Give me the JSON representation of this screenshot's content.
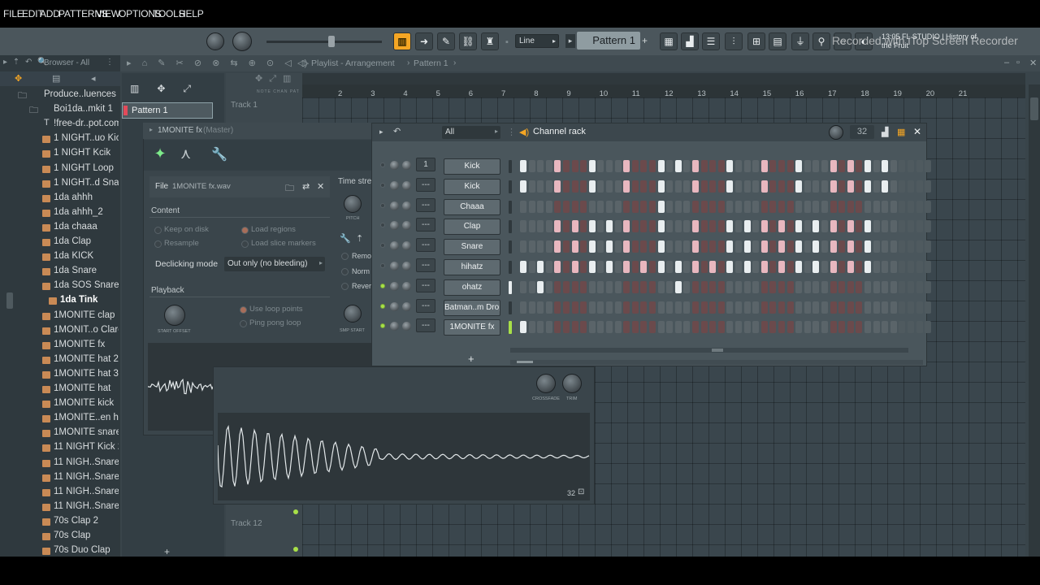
{
  "watermark": {
    "text": "Recorded with iTop Screen Recorder",
    "hint_line1": "13:05 FL STUDIO | History of",
    "hint_line2": "the Fruit"
  },
  "menu": [
    "FILE",
    "EDIT",
    "ADD",
    "PATTERNS",
    "VIEW",
    "OPTIONS",
    "TOOLS",
    "HELP"
  ],
  "toolbar": {
    "snap": "Line",
    "pattern": "Pattern 1",
    "add": "+"
  },
  "browser": {
    "title": "Browser - All",
    "items": [
      {
        "label": "Produce..luences",
        "kind": "folder-open"
      },
      {
        "label": "Boi1da..mkit 1",
        "kind": "folder-open"
      },
      {
        "label": "!free-dr..pot.com",
        "kind": "text"
      },
      {
        "label": "1 NIGHT..uo Kick",
        "kind": "folder"
      },
      {
        "label": "1 NIGHT Kcik",
        "kind": "folder"
      },
      {
        "label": "1 NIGHT Loop",
        "kind": "folder"
      },
      {
        "label": "1 NIGHT..d Snare",
        "kind": "folder"
      },
      {
        "label": "1da ahhh",
        "kind": "folder"
      },
      {
        "label": "1da ahhh_2",
        "kind": "folder"
      },
      {
        "label": "1da chaaa",
        "kind": "folder"
      },
      {
        "label": "1da Clap",
        "kind": "folder"
      },
      {
        "label": "1da KICK",
        "kind": "folder"
      },
      {
        "label": "1da Snare",
        "kind": "folder"
      },
      {
        "label": "1da SOS Snare",
        "kind": "folder"
      },
      {
        "label": "1da Tink",
        "kind": "folder-selected"
      },
      {
        "label": "1MONITE clap",
        "kind": "folder"
      },
      {
        "label": "1MONIT..o Clare",
        "kind": "folder"
      },
      {
        "label": "1MONITE fx",
        "kind": "folder"
      },
      {
        "label": "1MONITE hat 2",
        "kind": "folder"
      },
      {
        "label": "1MONITE hat 3",
        "kind": "folder"
      },
      {
        "label": "1MONITE hat",
        "kind": "folder"
      },
      {
        "label": "1MONITE kick",
        "kind": "folder"
      },
      {
        "label": "1MONITE..en hat",
        "kind": "folder"
      },
      {
        "label": "1MONITE snare",
        "kind": "folder"
      },
      {
        "label": "11 NIGHT Kick 2",
        "kind": "folder"
      },
      {
        "label": "11 NIGH..Snare 1",
        "kind": "folder"
      },
      {
        "label": "11 NIGH..Snare 2",
        "kind": "folder"
      },
      {
        "label": "11 NIGH..Snare 3",
        "kind": "folder"
      },
      {
        "label": "11 NIGH..Snare 4",
        "kind": "folder"
      },
      {
        "label": "70s Clap 2",
        "kind": "folder"
      },
      {
        "label": "70s Clap",
        "kind": "folder"
      },
      {
        "label": "70s Duo Clap",
        "kind": "folder"
      }
    ]
  },
  "playlist": {
    "title": "Playlist - Arrangement",
    "pattern_crumb": "Pattern 1",
    "picker_item": "Pattern 1",
    "track1": "Track 1",
    "track12": "Track 12",
    "ruler": [
      "2",
      "3",
      "4",
      "5",
      "6",
      "7",
      "8",
      "9",
      "10",
      "11",
      "12",
      "13",
      "14",
      "15",
      "16",
      "17",
      "18",
      "19",
      "20",
      "21"
    ],
    "mini_labels": [
      "NOTE",
      "CHAN",
      "PAT"
    ]
  },
  "sampler": {
    "title": "1MONITE fx",
    "route": "(Master)",
    "file_label": "File",
    "file_name": "1MONITE fx.wav",
    "content_heading": "Content",
    "keep_on_disk": "Keep on disk",
    "resample": "Resample",
    "load_regions": "Load regions",
    "load_slice_markers": "Load slice markers",
    "declicking_label": "Declicking mode",
    "declicking_value": "Out only (no bleeding)",
    "playback_heading": "Playback",
    "use_loop_points": "Use loop points",
    "ping_pong_loop": "Ping pong loop",
    "start_offset": "START OFFSET",
    "time_stretch": "Time stre",
    "pitch": "PITCH",
    "remove": "Remo",
    "normalize": "Norm",
    "reverse": "Rever",
    "smp_start": "SMP START",
    "wave_steps": "32",
    "crossfade": "CROSSFADE",
    "trim": "TRIM",
    "wave2_steps": "32"
  },
  "channel_rack": {
    "title": "Channel rack",
    "filter": "All",
    "steps": "32",
    "add": "+",
    "channels": [
      {
        "name": "Kick",
        "mixer": "1",
        "active": false,
        "steps": [
          0,
          4,
          8,
          12,
          16,
          18,
          20,
          24,
          28,
          32,
          36,
          38,
          40,
          42
        ]
      },
      {
        "name": "Kick",
        "mixer": "---",
        "active": false,
        "steps": [
          0,
          4,
          8,
          12,
          16,
          20,
          24,
          28,
          32,
          36,
          38,
          40,
          42
        ]
      },
      {
        "name": "Chaaa",
        "mixer": "---",
        "active": false,
        "steps": [
          16
        ]
      },
      {
        "name": "Clap",
        "mixer": "---",
        "active": false,
        "steps": [
          4,
          6,
          8,
          10,
          12,
          16,
          20,
          24,
          26,
          28,
          30,
          32,
          34,
          36,
          38,
          40
        ]
      },
      {
        "name": "Snare",
        "mixer": "---",
        "active": false,
        "steps": [
          4,
          6,
          8,
          10,
          12,
          16,
          20,
          24,
          26,
          28,
          30,
          32,
          34,
          36,
          38,
          40
        ]
      },
      {
        "name": "hihatz",
        "mixer": "---",
        "active": false,
        "steps": [
          0,
          2,
          4,
          6,
          8,
          10,
          12,
          14,
          16,
          18,
          20,
          22,
          24,
          26,
          28,
          30,
          32,
          34,
          36,
          38,
          40
        ]
      },
      {
        "name": "ohatz",
        "mixer": "---",
        "active": true,
        "steps": [
          2,
          18
        ]
      },
      {
        "name": "Batman..m Drop",
        "mixer": "---",
        "active": true,
        "steps": []
      },
      {
        "name": "1MONITE fx",
        "mixer": "---",
        "active": true,
        "steps": [
          0
        ]
      }
    ]
  },
  "colors": {
    "accent": "#f5a624",
    "step_red": "#6b4a4c",
    "step_grey": "#5a6469",
    "step_on_pink": "#e8b7bf",
    "step_on_white": "#e9eef0",
    "led_green": "#a8e048"
  }
}
